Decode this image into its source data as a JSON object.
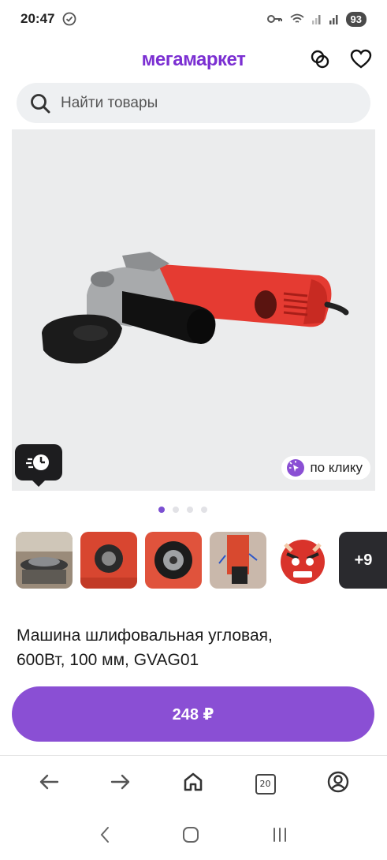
{
  "status_bar": {
    "time": "20:47",
    "battery": "93"
  },
  "header": {
    "logo": "мегамаркет"
  },
  "search": {
    "placeholder": "Найти товары"
  },
  "gallery": {
    "badge_right_label": "по клику",
    "dots_count": 4,
    "active_dot": 1
  },
  "thumbnails": {
    "more_label": "+9"
  },
  "product": {
    "title_line1": "Машина шлифовальная угловая,",
    "title_line2": "600Вт, 100 мм, GVAG01"
  },
  "buy": {
    "price_label": "248 ₽"
  },
  "browser_nav": {
    "tab_count": "20"
  },
  "colors": {
    "brand": "#7b2fd2",
    "buy_button": "#8a4fd4"
  }
}
